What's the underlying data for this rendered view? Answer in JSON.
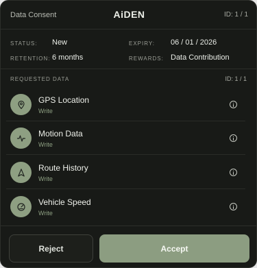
{
  "header": {
    "left": "Data Consent",
    "title": "AiDEN",
    "right": "ID: 1 / 1"
  },
  "info": {
    "status_key": "STATUS:",
    "status_value": "New",
    "retention_key": "RETENTION:",
    "retention_value": "6 months",
    "expiry_key": "EXPIRY:",
    "expiry_value": "06 / 01 / 2026",
    "rewards_key": "REWARDS:",
    "rewards_value": "Data Contribution"
  },
  "requested": {
    "label": "REQUESTED DATA",
    "id": "ID: 1 / 1",
    "items": [
      {
        "name": "GPS Location",
        "permission": "Write",
        "icon": "location-pin-icon"
      },
      {
        "name": "Motion Data",
        "permission": "Write",
        "icon": "activity-icon"
      },
      {
        "name": "Route History",
        "permission": "Write",
        "icon": "route-arrow-icon"
      },
      {
        "name": "Vehicle Speed",
        "permission": "Write",
        "icon": "speedometer-icon"
      }
    ]
  },
  "footer": {
    "reject_label": "Reject",
    "accept_label": "Accept"
  },
  "colors": {
    "background": "#181a17",
    "accent": "#8c9d81",
    "text": "#eef0ea",
    "permission": "#8fa183"
  }
}
